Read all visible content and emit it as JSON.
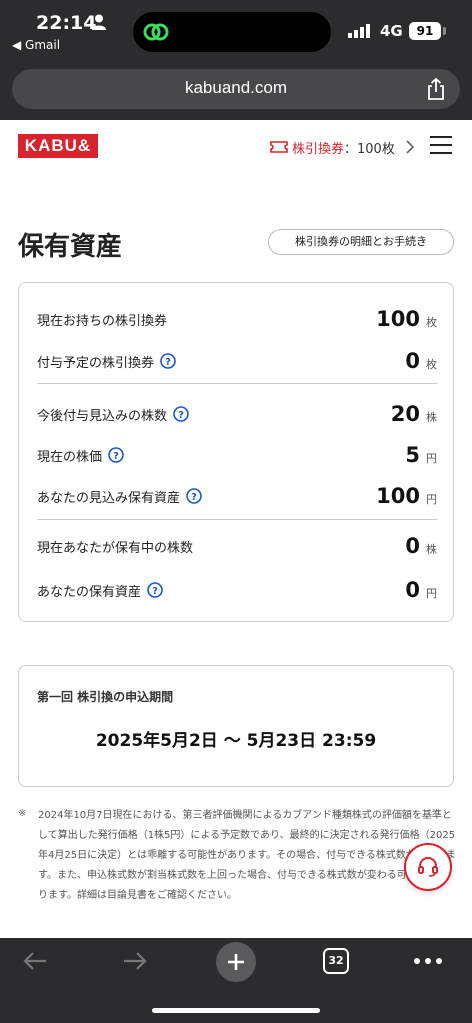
{
  "status": {
    "time": "22:14",
    "back_app": "◀ Gmail",
    "network": "4G",
    "battery": "91"
  },
  "browser": {
    "url": "kabuand.com",
    "open_tabs": "32"
  },
  "header": {
    "logo": "KABU&",
    "ticket_name": "株引換券",
    "ticket_count": "：100枚"
  },
  "page": {
    "title": "保有資産",
    "detail_button": "株引換券の明細とお手続き"
  },
  "assets": [
    {
      "label": "現在お持ちの株引換券",
      "value": "100",
      "unit": "枚"
    },
    {
      "label": "付与予定の株引換券",
      "value": "0",
      "unit": "枚"
    },
    {
      "label": "今後付与見込みの株数",
      "value": "20",
      "unit": "株"
    },
    {
      "label": "現在の株価",
      "value": "5",
      "unit": "円"
    },
    {
      "label": "あなたの見込み保有資産",
      "value": "100",
      "unit": "円"
    },
    {
      "label": "現在あなたが保有中の株数",
      "value": "0",
      "unit": "株"
    },
    {
      "label": "あなたの保有資産",
      "value": "0",
      "unit": "円"
    }
  ],
  "period": {
    "label": "第一回 株引換の申込期間",
    "value": "2025年5月2日 〜 5月23日 23:59"
  },
  "note": {
    "mark": "※",
    "text": "2024年10月7日現在における、第三者評価機関によるカブアンド種類株式の評価額を基準として算出した発行価格（1株5円）による予定数であり、最終的に決定される発行価格（2025年4月25日に決定）とは乖離する可能性があります。その場合、付与できる株式数が異なります。また、申込株式数が割当株式数を上回った場合、付与できる株式数が変わる可能性があります。詳細は目論見書をご確認ください。"
  },
  "colors": {
    "brand": "#d8242c",
    "help": "#1a56c4",
    "chrome": "#2c2c2e"
  }
}
